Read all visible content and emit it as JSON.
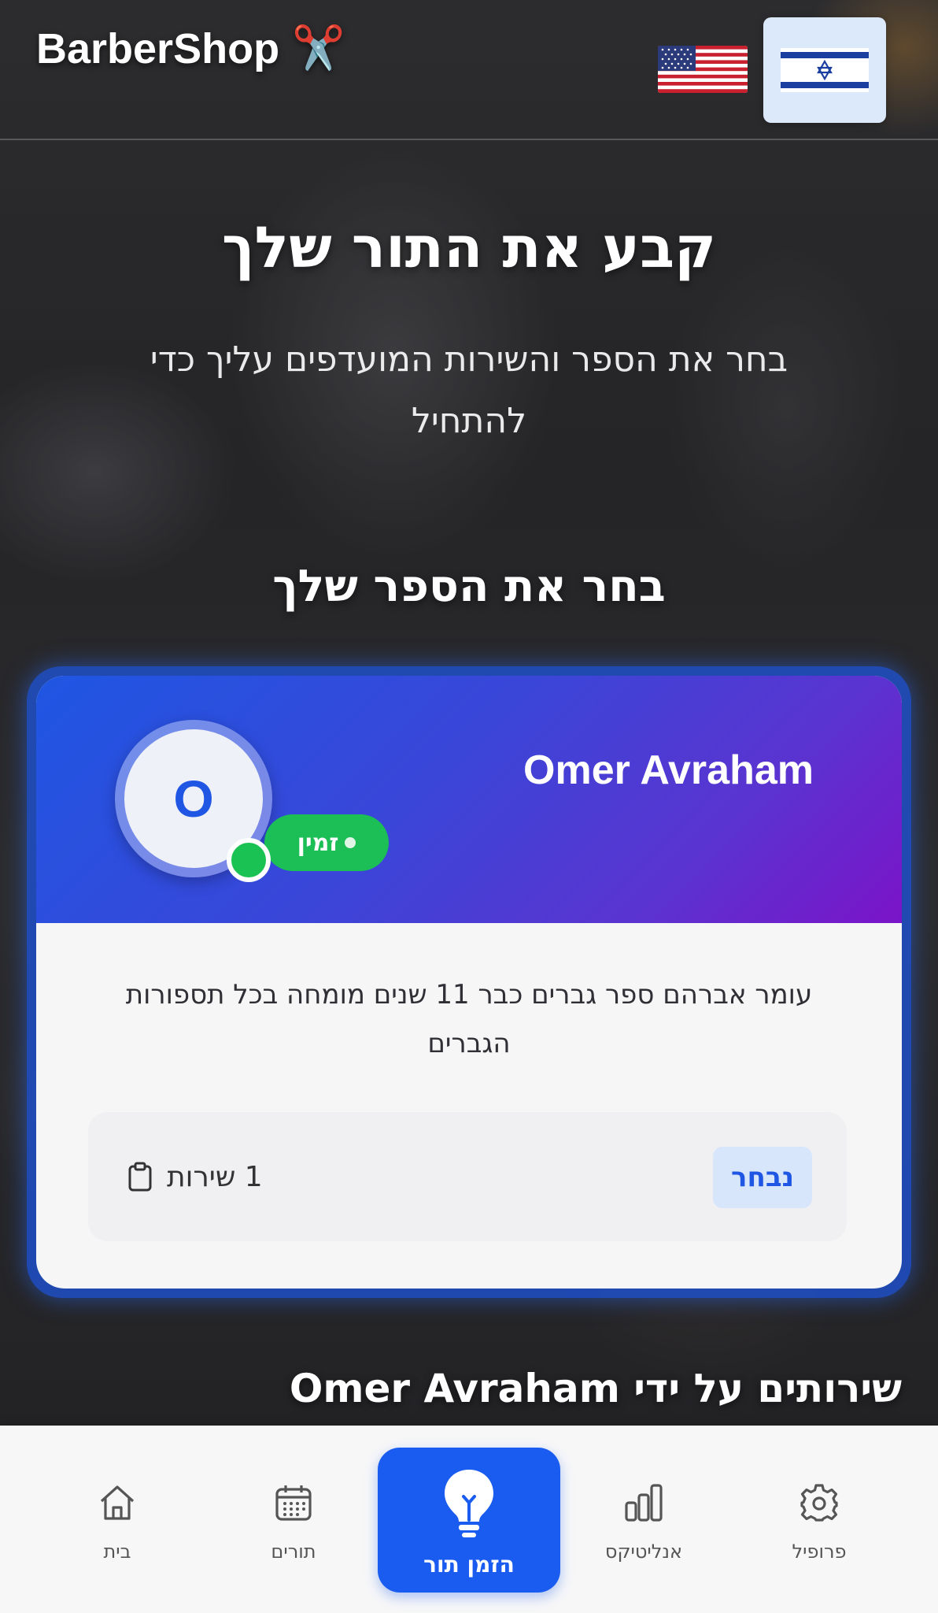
{
  "header": {
    "brand": "BarberShop",
    "brand_icon": "scissors-icon",
    "languages": [
      {
        "code": "en",
        "icon": "us-flag-icon",
        "selected": false
      },
      {
        "code": "he",
        "icon": "israel-flag-icon",
        "selected": true
      }
    ]
  },
  "hero": {
    "title": "קבע את התור שלך",
    "subtitle": "בחר את הספר והשירות המועדפים עליך כדי להתחיל"
  },
  "barber_section": {
    "title": "בחר את הספר שלך"
  },
  "barber_card": {
    "name": "Omer Avraham",
    "avatar_initial": "O",
    "status": "זמין",
    "description": "עומר אברהם ספר גברים כבר 11 שנים מומחה בכל תספורות הגברים",
    "service_count": "1 שירות",
    "service_icon": "clipboard-icon",
    "selected_label": "נבחר",
    "colors": {
      "gradient_start": "#1f56e3",
      "gradient_end": "#7a14c8",
      "status": "#1bbf55"
    }
  },
  "services_section": {
    "title": "שירותים על ידי Omer Avraham"
  },
  "bottom_nav": {
    "items": [
      {
        "label": "בית",
        "icon": "home-icon"
      },
      {
        "label": "תורים",
        "icon": "calendar-icon"
      },
      {
        "label": "הזמן תור",
        "icon": "lightbulb-icon",
        "active": true
      },
      {
        "label": "אנליטיקס",
        "icon": "bar-chart-icon"
      },
      {
        "label": "פרופיל",
        "icon": "gear-icon"
      }
    ],
    "accent": "#1a5cf0"
  }
}
